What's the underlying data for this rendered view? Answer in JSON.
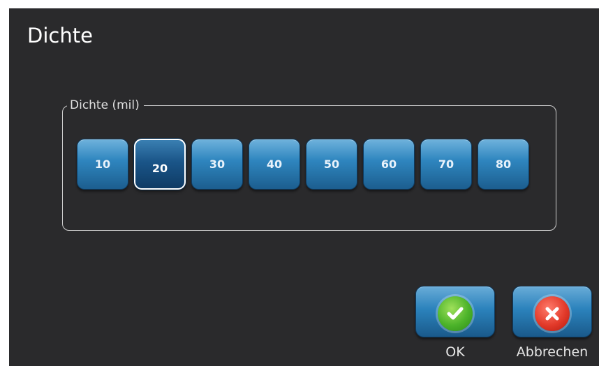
{
  "dialog": {
    "title": "Dichte"
  },
  "density": {
    "group_label": "Dichte (mil)",
    "options": [
      "10",
      "20",
      "30",
      "40",
      "50",
      "60",
      "70",
      "80"
    ],
    "selected": "20"
  },
  "actions": {
    "ok": {
      "label": "OK",
      "icon": "check-icon",
      "color": "#4cb32a"
    },
    "cancel": {
      "label": "Abbrechen",
      "icon": "close-icon",
      "color": "#e23a2a"
    }
  },
  "colors": {
    "background": "#2a2a2c",
    "button": "#2f86bf"
  }
}
